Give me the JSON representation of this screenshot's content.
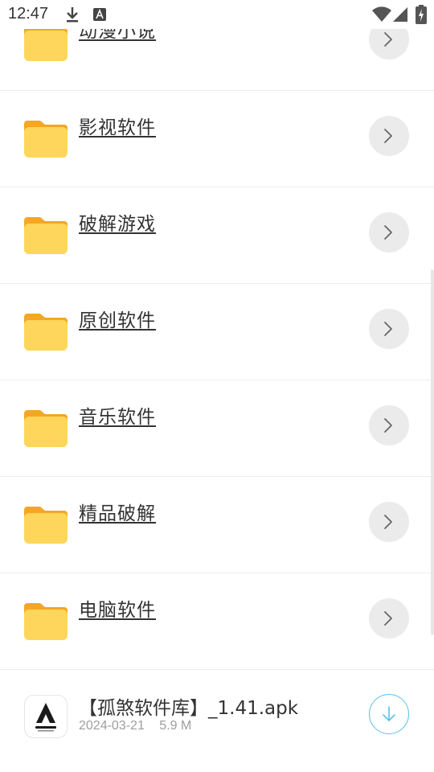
{
  "status_bar": {
    "time": "12:47",
    "icons": [
      "download-icon",
      "a-badge-icon",
      "wifi-icon",
      "signal-icon",
      "battery-icon"
    ]
  },
  "folders": [
    {
      "label": "动漫小说 "
    },
    {
      "label": "影视软件 "
    },
    {
      "label": "破解游戏 "
    },
    {
      "label": "原创软件 "
    },
    {
      "label": "音乐软件 "
    },
    {
      "label": "精品破解 "
    },
    {
      "label": "电脑软件 "
    }
  ],
  "file": {
    "name": "【孤煞软件库】_1.41.apk",
    "date": "2024-03-21",
    "size": "5.9 M"
  },
  "colors": {
    "folder_back": "#F5A623",
    "folder_front": "#FDD65B",
    "chevron_bg": "#EBEBEB",
    "download_accent": "#5BC2EA"
  }
}
